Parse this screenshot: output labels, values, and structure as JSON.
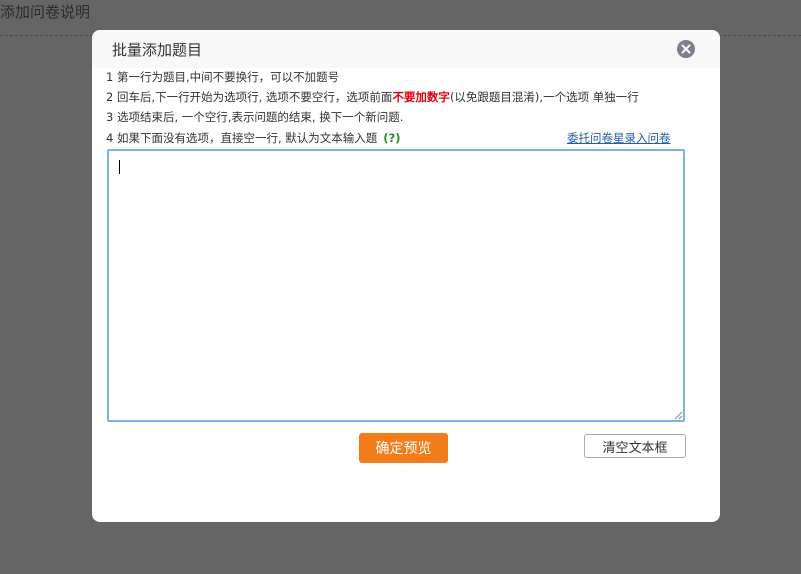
{
  "background": {
    "title": "添加问卷说明"
  },
  "modal": {
    "title": "批量添加题目",
    "close_icon": "close-icon"
  },
  "instructions": {
    "line1": "1 第一行为题目,中间不要换行，可以不加题号",
    "line2_prefix": "2 回车后,下一行开始为选项行, 选项不要空行，选项前面",
    "line2_highlight": "不要加数字",
    "line2_suffix": "(以免跟题目混淆),一个选项 单独一行",
    "line3": "3 选项结束后, 一个空行,表示问题的结束, 换下一个新问题.",
    "line4": "4 如果下面没有选项，直接空一行, 默认为文本输入题",
    "help_mark": "(?)"
  },
  "links": {
    "entrust": "委托问卷星录入问卷"
  },
  "textarea": {
    "value": ""
  },
  "buttons": {
    "confirm_label": "确定预览",
    "clear_label": "清空文本框"
  },
  "colors": {
    "overlay": "#656565",
    "accent_orange": "#f27b1a",
    "highlight_red": "#e60012",
    "help_green": "#2b8a2b",
    "link_blue": "#1f5fa8",
    "input_border": "#7fb2e5"
  }
}
